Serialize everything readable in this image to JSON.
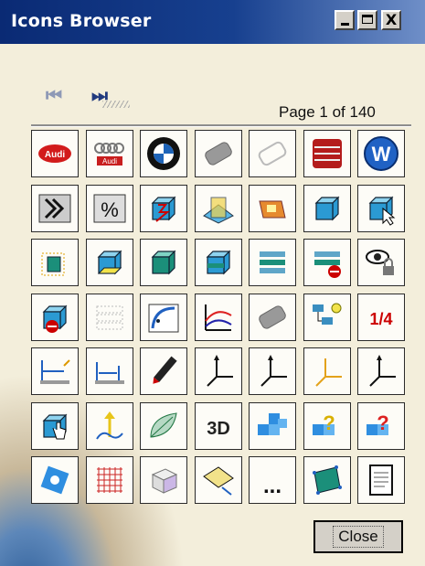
{
  "window": {
    "title": "Icons Browser",
    "controls": {
      "minimize": "_",
      "maximize": "□",
      "close": "X"
    }
  },
  "navigation": {
    "first_icon": "skip-first-icon",
    "last_icon": "skip-last-icon",
    "first_glyph": "⏮",
    "last_glyph": "⏭"
  },
  "page_label": "Page 1 of 140",
  "icons": [
    [
      "audi-red-logo-icon",
      "audi-rings-logo-icon",
      "bmw-logo-icon",
      "grey-part-icon",
      "ghost-part-icon",
      "seat-logo-icon",
      "vw-logo-icon"
    ],
    [
      "fast-forward-chevron-icon",
      "percent-icon",
      "red-lightning-box-icon",
      "plane-intersect-icon",
      "orange-part-icon",
      "box-icon",
      "arrow-cursor-box-icon"
    ],
    [
      "green-dotted-box-icon",
      "yellow-face-box-icon",
      "green-box-icon",
      "green-split-box-icon",
      "green-stack-icon",
      "stack-minus-icon",
      "eye-lock-icon"
    ],
    [
      "box-minus-red-icon",
      "dotted-stack-icon",
      "curved-arrow-icon",
      "axis-curves-icon",
      "grey-part-2-icon",
      "tree-bulb-icon",
      "1-4-red-icon"
    ],
    [
      "measure-height-icon",
      "measure-angle-icon",
      "black-pen-icon",
      "axis-black-icon",
      "axis-thin-icon",
      "axis-orange-icon",
      "axis-small-icon"
    ],
    [
      "hand-cursor-box-icon",
      "yellow-arrow-icon",
      "leaf-icon",
      "3d-text-icon",
      "blue-cubes-icon",
      "question-cubes-icon",
      "red-question-cubes-icon"
    ],
    [
      "blue-gear-icon",
      "red-grid-icon",
      "white-cube-icon",
      "diagonal-plane-icon",
      "ellipsis-icon",
      "green-diamond-icon",
      "document-icon"
    ]
  ],
  "cell_labels": {
    "3d-text-icon": "3D",
    "ellipsis-icon": "...",
    "1-4-red-icon": "1/4"
  },
  "close_label": "Close"
}
